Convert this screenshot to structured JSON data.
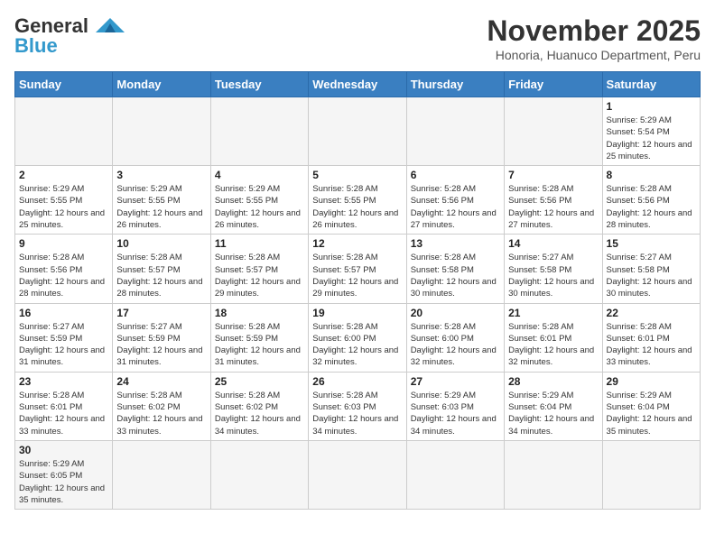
{
  "logo": {
    "general": "General",
    "blue": "Blue"
  },
  "header": {
    "month_title": "November 2025",
    "subtitle": "Honoria, Huanuco Department, Peru"
  },
  "weekdays": [
    "Sunday",
    "Monday",
    "Tuesday",
    "Wednesday",
    "Thursday",
    "Friday",
    "Saturday"
  ],
  "weeks": [
    [
      {
        "day": "",
        "info": ""
      },
      {
        "day": "",
        "info": ""
      },
      {
        "day": "",
        "info": ""
      },
      {
        "day": "",
        "info": ""
      },
      {
        "day": "",
        "info": ""
      },
      {
        "day": "",
        "info": ""
      },
      {
        "day": "1",
        "info": "Sunrise: 5:29 AM\nSunset: 5:54 PM\nDaylight: 12 hours and 25 minutes."
      }
    ],
    [
      {
        "day": "2",
        "info": "Sunrise: 5:29 AM\nSunset: 5:55 PM\nDaylight: 12 hours and 25 minutes."
      },
      {
        "day": "3",
        "info": "Sunrise: 5:29 AM\nSunset: 5:55 PM\nDaylight: 12 hours and 26 minutes."
      },
      {
        "day": "4",
        "info": "Sunrise: 5:29 AM\nSunset: 5:55 PM\nDaylight: 12 hours and 26 minutes."
      },
      {
        "day": "5",
        "info": "Sunrise: 5:28 AM\nSunset: 5:55 PM\nDaylight: 12 hours and 26 minutes."
      },
      {
        "day": "6",
        "info": "Sunrise: 5:28 AM\nSunset: 5:56 PM\nDaylight: 12 hours and 27 minutes."
      },
      {
        "day": "7",
        "info": "Sunrise: 5:28 AM\nSunset: 5:56 PM\nDaylight: 12 hours and 27 minutes."
      },
      {
        "day": "8",
        "info": "Sunrise: 5:28 AM\nSunset: 5:56 PM\nDaylight: 12 hours and 28 minutes."
      }
    ],
    [
      {
        "day": "9",
        "info": "Sunrise: 5:28 AM\nSunset: 5:56 PM\nDaylight: 12 hours and 28 minutes."
      },
      {
        "day": "10",
        "info": "Sunrise: 5:28 AM\nSunset: 5:57 PM\nDaylight: 12 hours and 28 minutes."
      },
      {
        "day": "11",
        "info": "Sunrise: 5:28 AM\nSunset: 5:57 PM\nDaylight: 12 hours and 29 minutes."
      },
      {
        "day": "12",
        "info": "Sunrise: 5:28 AM\nSunset: 5:57 PM\nDaylight: 12 hours and 29 minutes."
      },
      {
        "day": "13",
        "info": "Sunrise: 5:28 AM\nSunset: 5:58 PM\nDaylight: 12 hours and 30 minutes."
      },
      {
        "day": "14",
        "info": "Sunrise: 5:27 AM\nSunset: 5:58 PM\nDaylight: 12 hours and 30 minutes."
      },
      {
        "day": "15",
        "info": "Sunrise: 5:27 AM\nSunset: 5:58 PM\nDaylight: 12 hours and 30 minutes."
      }
    ],
    [
      {
        "day": "16",
        "info": "Sunrise: 5:27 AM\nSunset: 5:59 PM\nDaylight: 12 hours and 31 minutes."
      },
      {
        "day": "17",
        "info": "Sunrise: 5:27 AM\nSunset: 5:59 PM\nDaylight: 12 hours and 31 minutes."
      },
      {
        "day": "18",
        "info": "Sunrise: 5:28 AM\nSunset: 5:59 PM\nDaylight: 12 hours and 31 minutes."
      },
      {
        "day": "19",
        "info": "Sunrise: 5:28 AM\nSunset: 6:00 PM\nDaylight: 12 hours and 32 minutes."
      },
      {
        "day": "20",
        "info": "Sunrise: 5:28 AM\nSunset: 6:00 PM\nDaylight: 12 hours and 32 minutes."
      },
      {
        "day": "21",
        "info": "Sunrise: 5:28 AM\nSunset: 6:01 PM\nDaylight: 12 hours and 32 minutes."
      },
      {
        "day": "22",
        "info": "Sunrise: 5:28 AM\nSunset: 6:01 PM\nDaylight: 12 hours and 33 minutes."
      }
    ],
    [
      {
        "day": "23",
        "info": "Sunrise: 5:28 AM\nSunset: 6:01 PM\nDaylight: 12 hours and 33 minutes."
      },
      {
        "day": "24",
        "info": "Sunrise: 5:28 AM\nSunset: 6:02 PM\nDaylight: 12 hours and 33 minutes."
      },
      {
        "day": "25",
        "info": "Sunrise: 5:28 AM\nSunset: 6:02 PM\nDaylight: 12 hours and 34 minutes."
      },
      {
        "day": "26",
        "info": "Sunrise: 5:28 AM\nSunset: 6:03 PM\nDaylight: 12 hours and 34 minutes."
      },
      {
        "day": "27",
        "info": "Sunrise: 5:29 AM\nSunset: 6:03 PM\nDaylight: 12 hours and 34 minutes."
      },
      {
        "day": "28",
        "info": "Sunrise: 5:29 AM\nSunset: 6:04 PM\nDaylight: 12 hours and 34 minutes."
      },
      {
        "day": "29",
        "info": "Sunrise: 5:29 AM\nSunset: 6:04 PM\nDaylight: 12 hours and 35 minutes."
      }
    ],
    [
      {
        "day": "30",
        "info": "Sunrise: 5:29 AM\nSunset: 6:05 PM\nDaylight: 12 hours and 35 minutes."
      },
      {
        "day": "",
        "info": ""
      },
      {
        "day": "",
        "info": ""
      },
      {
        "day": "",
        "info": ""
      },
      {
        "day": "",
        "info": ""
      },
      {
        "day": "",
        "info": ""
      },
      {
        "day": "",
        "info": ""
      }
    ]
  ]
}
